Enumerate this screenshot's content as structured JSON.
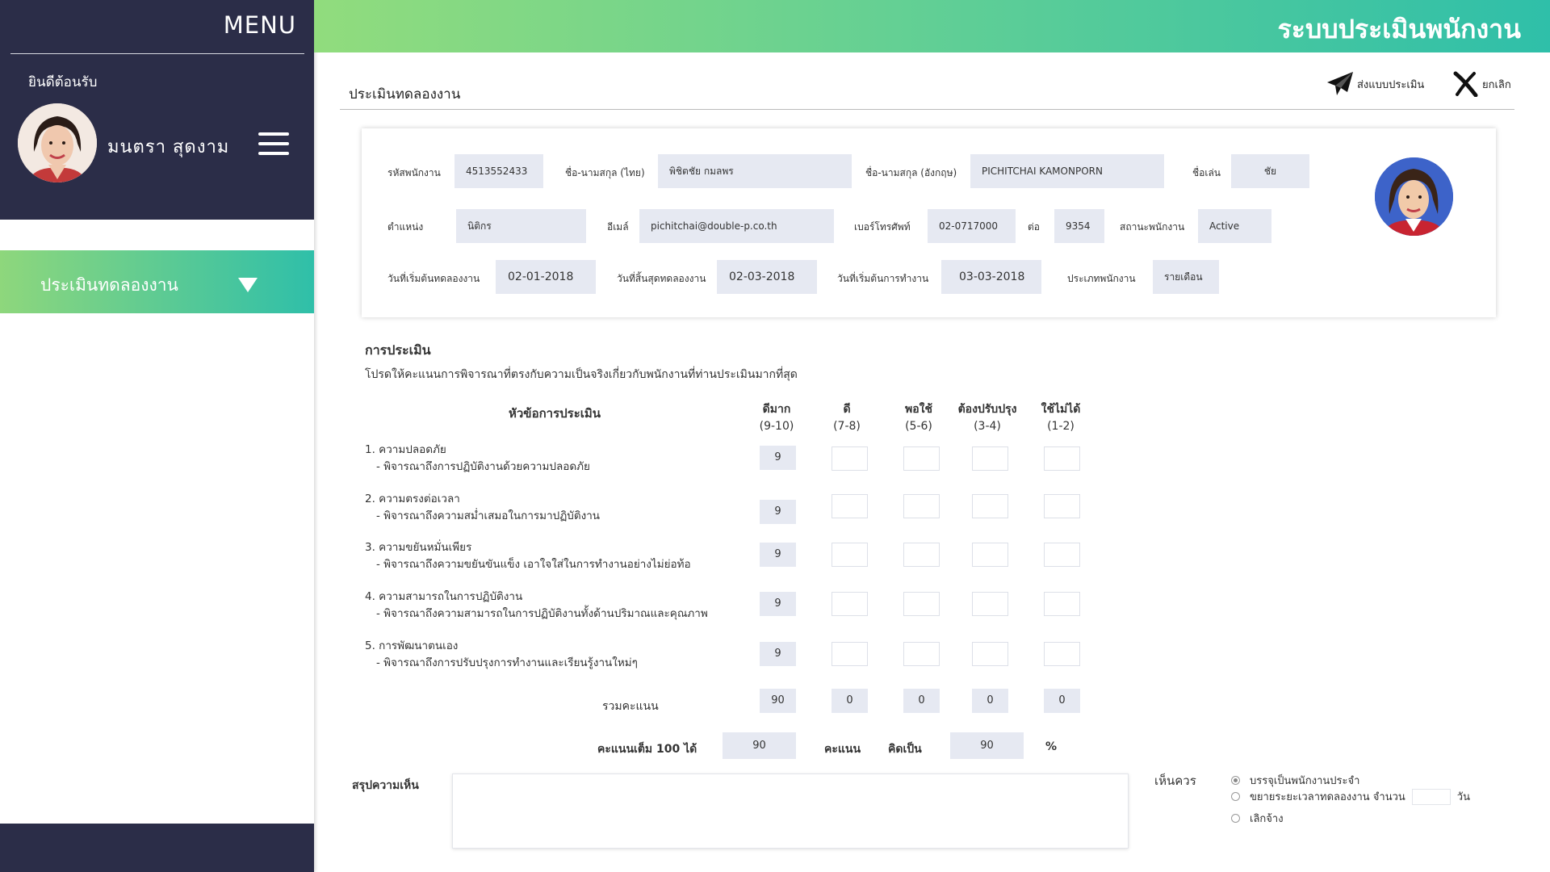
{
  "sidebar": {
    "menu_title": "MENU",
    "welcome": "ยินดีต้อนรับ",
    "user_name": "มนตรา  สุดงาม",
    "nav_item": "ประเมินทดลองงาน"
  },
  "header": {
    "title": "ระบบประเมินพนักงาน"
  },
  "page": {
    "title": "ประเมินทดลองงาน",
    "submit_label": "ส่งแบบประเมิน",
    "cancel_label": "ยกเลิก"
  },
  "employee": {
    "id_label": "รหัสพนักงาน",
    "id": "4513552433",
    "name_th_label": "ชื่อ-นามสกุล (ไทย)",
    "name_th": "พิชิตชัย    กมลพร",
    "name_en_label": "ชื่อ-นามสกุล (อังกฤษ)",
    "name_en": "PICHITCHAI     KAMONPORN",
    "nickname_label": "ชื่อเล่น",
    "nickname": "ชัย",
    "position_label": "ตำแหน่ง",
    "position": "นิติกร",
    "email_label": "อีเมล์",
    "email": "pichitchai@double-p.co.th",
    "phone_label": "เบอร์โทรศัพท์",
    "phone": "02-0717000",
    "ext_label": "ต่อ",
    "ext": "9354",
    "status_label": "สถานะพนักงาน",
    "status": "Active",
    "trial_start_label": "วันที่เริ่มต้นทดลองงาน",
    "trial_start": "02-01-2018",
    "trial_end_label": "วันที่สิ้นสุดทดลองงาน",
    "trial_end": "02-03-2018",
    "work_start_label": "วันที่เริ่มต้นการทำงาน",
    "work_start": "03-03-2018",
    "type_label": "ประเภทพนักงาน",
    "type": "รายเดือน"
  },
  "evaluation": {
    "title": "การประเมิน",
    "description": "โปรดให้คะแนนการพิจารณาที่ตรงกับความเป็นจริงเกี่ยวกับพนักงานที่ท่านประเมินมากที่สุด",
    "topic_header": "หัวข้อการประเมิน",
    "columns": [
      {
        "name": "ดีมาก",
        "range": "(9-10)"
      },
      {
        "name": "ดี",
        "range": "(7-8)"
      },
      {
        "name": "พอใช้",
        "range": "(5-6)"
      },
      {
        "name": "ต้องปรับปรุง",
        "range": "(3-4)"
      },
      {
        "name": "ใช้ไม่ได้",
        "range": "(1-2)"
      }
    ],
    "criteria": [
      {
        "title": "1.  ความปลอดภัย",
        "desc": "- พิจารณาถึงการปฏิบัติงานด้วยความปลอดภัย",
        "scores": [
          "9",
          "",
          "",
          "",
          ""
        ]
      },
      {
        "title": "2.  ความตรงต่อเวลา",
        "desc": "- พิจารณาถึงความสม่ำเสมอในการมาปฏิบัติงาน",
        "scores": [
          "9",
          "",
          "",
          "",
          ""
        ]
      },
      {
        "title": "3.  ความขยันหมั่นเพียร",
        "desc": "- พิจารณาถึงความขยันขันแข็ง เอาใจใส่ในการทำงานอย่างไม่ย่อท้อ",
        "scores": [
          "9",
          "",
          "",
          "",
          ""
        ]
      },
      {
        "title": "4.  ความสามารถในการปฏิบัติงาน",
        "desc": "- พิจารณาถึงความสามารถในการปฏิบัติงานทั้งด้านปริมาณและคุณภาพ",
        "scores": [
          "9",
          "",
          "",
          "",
          ""
        ]
      },
      {
        "title": "5.  การพัฒนาตนเอง",
        "desc": "- พิจารณาถึงการปรับปรุงการทำงานและเรียนรู้งานใหม่ๆ",
        "scores": [
          "9",
          "",
          "",
          "",
          ""
        ]
      }
    ],
    "total_label": "รวมคะแนน",
    "totals": [
      "90",
      "0",
      "0",
      "0",
      "0"
    ],
    "full_score_label": "คะแนนเต็ม 100  ได้",
    "score": "90",
    "score_unit": "คะแนน",
    "percent_label": "คิดเป็น",
    "percent": "90",
    "percent_sign": "%",
    "summary_label": "สรุปความเห็น",
    "summary_value": "",
    "recommend_label": "เห็นควร",
    "options": [
      "บรรจุเป็นพนักงานประจำ",
      "ขยายระยะเวลาทดลองงาน  จำนวน",
      "เลิกจ้าง"
    ],
    "days_unit": "วัน"
  },
  "colors": {
    "sidebar_bg": "#2b2d48",
    "accent_start": "#8ed77c",
    "accent_end": "#2fbfa9",
    "field_bg": "#e6e9f2"
  }
}
